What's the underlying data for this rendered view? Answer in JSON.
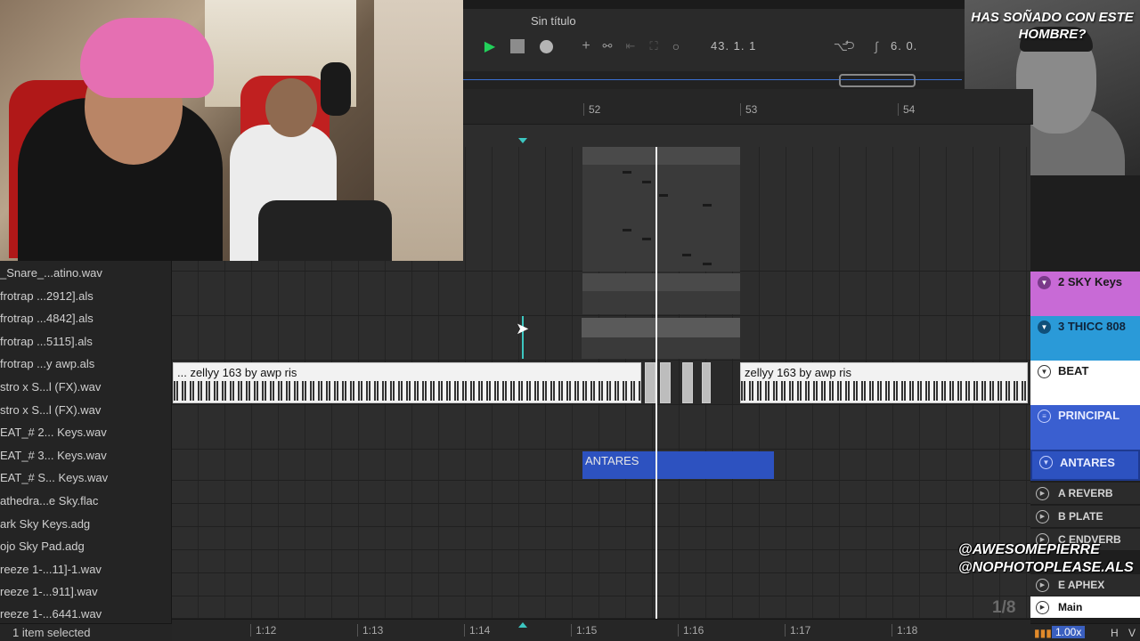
{
  "app": {
    "song_title": "Sin título",
    "position": "43.  1.  1",
    "loop_length": "6.  0."
  },
  "ruler": {
    "bars": [
      "52",
      "53",
      "54"
    ]
  },
  "time_ruler": {
    "labels": [
      "1:12",
      "1:13",
      "1:14",
      "1:15",
      "1:16",
      "1:17",
      "1:18"
    ]
  },
  "browser": {
    "items": [
      "_Snare_...atino.wav",
      "frotrap ...2912].als",
      "frotrap ...4842].als",
      "frotrap ...5115].als",
      "frotrap ...y awp.als",
      "stro x S...l (FX).wav",
      "stro x S...l (FX).wav",
      "EAT_# 2... Keys.wav",
      "EAT_# 3... Keys.wav",
      "EAT_# S... Keys.wav",
      "athedra...e Sky.flac",
      "ark Sky Keys.adg",
      "ojo Sky Pad.adg",
      "reeze 1-...11]-1.wav",
      "reeze 1-...911].wav",
      "reeze 1-...6441.wav"
    ]
  },
  "status": {
    "selection": "1 item selected"
  },
  "clips": {
    "beat_a": "... zellyy 163 by awp ris",
    "beat_b": "zellyy 163 by awp ris",
    "antares": "ANTARES"
  },
  "tracks": [
    {
      "name": "2 SKY Keys",
      "color": "#c86ad6"
    },
    {
      "name": "3 THICC 808",
      "color": "#2a9ad8"
    },
    {
      "name": "BEAT",
      "color": "#ffffff"
    },
    {
      "name": "PRINCIPAL",
      "color": "#3a5fd0"
    },
    {
      "name": "ANTARES",
      "color": "#3a5fd0"
    }
  ],
  "returns": [
    "A REVERB",
    "B PLATE",
    "C ENDVERB",
    "E APHEX",
    "Main"
  ],
  "overlay": {
    "reaction_caption": "HAS SOÑADO CON ESTE HOMBRE?",
    "watermark_1": "@AWESOMEPIERRE",
    "watermark_2": "@NOPHOTOPLEASE.ALS",
    "page_counter": "1/8"
  },
  "footer": {
    "zoom": "1.00x",
    "h": "H",
    "v": "V"
  },
  "colors": {
    "play": "#22d05a",
    "loop_marker": "#3cc6c0",
    "antares_clip": "#2d52c0"
  }
}
